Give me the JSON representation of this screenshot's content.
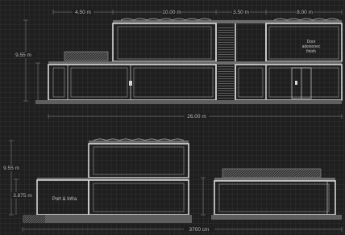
{
  "section_top": {
    "dims_top": [
      "4.50 m",
      "10.00 m",
      "3.50 m",
      "8.00 m"
    ],
    "height_dim": "9.55 m",
    "total_dim": "26.00 m",
    "room_label_lines": [
      "Door",
      "adesionec",
      "finish"
    ]
  },
  "section_bottom": {
    "height_total": "9.55 m",
    "height_lower": "3.875 m",
    "room_label": "Port & Infra",
    "total_dim": "3700 cm"
  }
}
